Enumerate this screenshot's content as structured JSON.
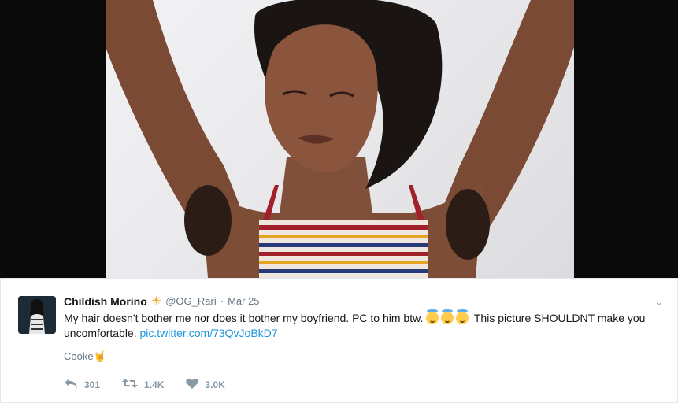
{
  "tweet": {
    "display_name": "Childish Morino",
    "name_emoji": "☀",
    "handle": "@OG_Rari",
    "separator": "·",
    "date": "Mar 25",
    "text_part1": "My hair doesn't bother me nor does it bother my boyfriend. PC to him btw.",
    "text_part2": "This picture SHOULDNT make you uncomfortable.",
    "link": "pic.twitter.com/73QvJoBkD7",
    "card_title": "Cooke",
    "card_emoji": "🤘",
    "caret": "⌄"
  },
  "actions": {
    "reply_count": "301",
    "retweet_count": "1.4K",
    "like_count": "3.0K",
    "reply_icon": "reply-icon",
    "retweet_icon": "retweet-icon",
    "like_icon": "heart-icon"
  },
  "colors": {
    "link": "#1b95e0",
    "muted": "#657786",
    "text": "#14171a"
  }
}
